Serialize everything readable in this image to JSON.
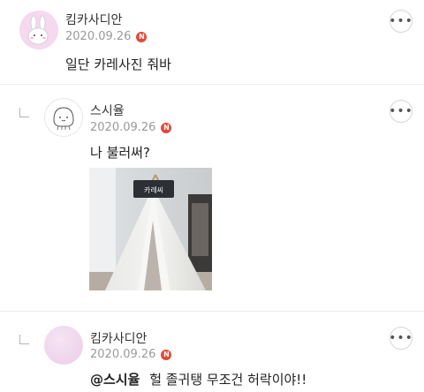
{
  "comments": [
    {
      "author": "킴카사디안",
      "date": "2020.09.26",
      "badge": "N",
      "text": "일단 카레사진 줘바",
      "avatar_icon": "bunny-icon",
      "avatar_color": "#f3d7ef"
    },
    {
      "author": "스시율",
      "date": "2020.09.26",
      "badge": "N",
      "text": "나 불러써?",
      "avatar_icon": "smiley-character-icon",
      "has_photo": true,
      "photo_sign": "카레씨"
    },
    {
      "author": "킴카사디안",
      "date": "2020.09.26",
      "badge": "N",
      "mention": "@스시율",
      "text": "헐 졸귀탱 무조건 허락이야!!",
      "avatar_color": "#f0d8f0"
    }
  ],
  "more_button_label": "•••"
}
